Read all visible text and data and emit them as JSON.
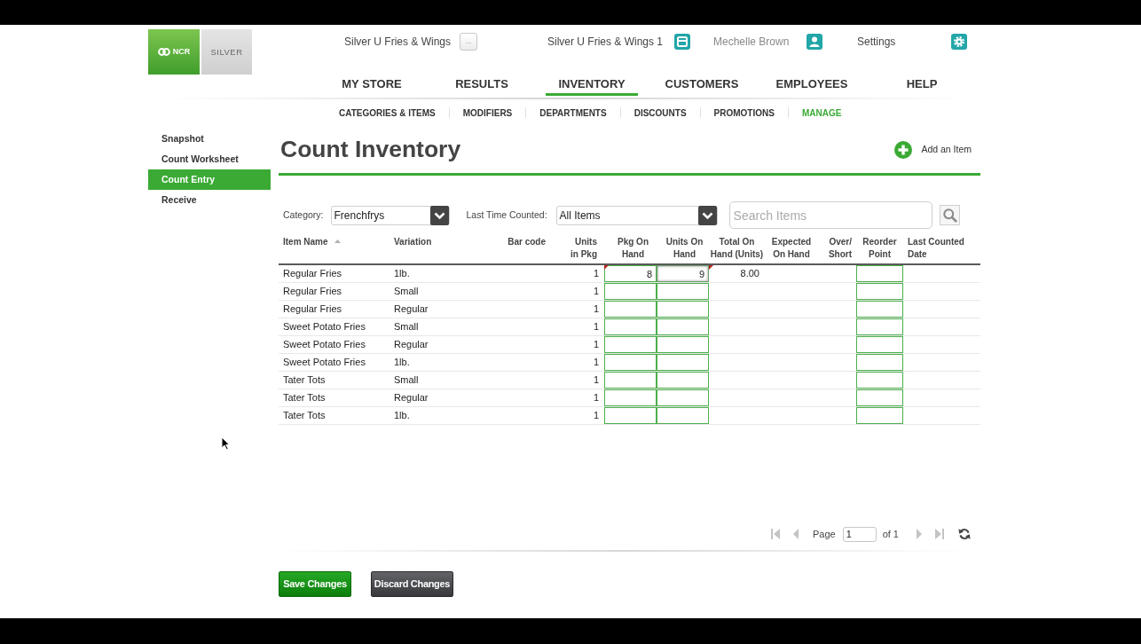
{
  "brand": {
    "company_logo": "NCR",
    "product_logo": "SILVER"
  },
  "account_bar": {
    "store": "Silver U Fries & Wings",
    "store_menu_button": "...",
    "location": "Silver U Fries & Wings 1",
    "user": "Mechelle Brown",
    "settings": "Settings"
  },
  "main_nav": [
    {
      "label": "MY STORE",
      "selected": false
    },
    {
      "label": "RESULTS",
      "selected": false
    },
    {
      "label": "INVENTORY",
      "selected": true
    },
    {
      "label": "CUSTOMERS",
      "selected": false
    },
    {
      "label": "EMPLOYEES",
      "selected": false
    },
    {
      "label": "HELP",
      "selected": false
    }
  ],
  "sub_nav": [
    {
      "label": "CATEGORIES & ITEMS",
      "selected": false
    },
    {
      "label": "MODIFIERS",
      "selected": false
    },
    {
      "label": "DEPARTMENTS",
      "selected": false
    },
    {
      "label": "DISCOUNTS",
      "selected": false
    },
    {
      "label": "PROMOTIONS",
      "selected": false
    },
    {
      "label": "MANAGE",
      "selected": true
    }
  ],
  "sidebar": {
    "items": [
      {
        "label": "Snapshot",
        "selected": false
      },
      {
        "label": "Count Worksheet",
        "selected": false
      },
      {
        "label": "Count Entry",
        "selected": true
      },
      {
        "label": "Receive",
        "selected": false
      }
    ]
  },
  "page": {
    "title": "Count Inventory",
    "add_item_button": "Add an Item"
  },
  "filters": {
    "category": {
      "label": "Category:",
      "value": "Frenchfrys"
    },
    "last_time_counted": {
      "label": "Last Time Counted:",
      "value": "All Items"
    },
    "search": {
      "placeholder": "Search Items"
    }
  },
  "table": {
    "columns": [
      {
        "label": "Item Name",
        "sorted": true
      },
      {
        "label": "Variation",
        "sorted": false
      },
      {
        "label": "Bar code",
        "sorted": false
      },
      {
        "label": "Units\nin Pkg",
        "sorted": false
      },
      {
        "label": "Pkg On\nHand",
        "sorted": false
      },
      {
        "label": "Units On\nHand",
        "sorted": false
      },
      {
        "label": "Total On\nHand (Units)",
        "sorted": false
      },
      {
        "label": "Expected\nOn Hand",
        "sorted": false
      },
      {
        "label": "Over/\nShort",
        "sorted": false
      },
      {
        "label": "Reorder\nPoint",
        "sorted": false
      },
      {
        "label": "Last Counted\nDate",
        "sorted": false
      }
    ],
    "rows": [
      {
        "item_name": "Regular Fries",
        "variation": "1lb.",
        "units_in_pkg": "1",
        "pkg_on_hand": "8",
        "units_on_hand": "9",
        "total_on_hand": "8.00",
        "pkg_on_hand_changed": true,
        "units_on_hand_editing": true,
        "total_changed": true
      },
      {
        "item_name": "Regular Fries",
        "variation": "Small",
        "units_in_pkg": "1",
        "pkg_on_hand_changed": false,
        "units_on_hand_editing": false,
        "total_changed": false
      },
      {
        "item_name": "Regular Fries",
        "variation": "Regular",
        "units_in_pkg": "1",
        "pkg_on_hand_changed": false,
        "units_on_hand_editing": false,
        "total_changed": false
      },
      {
        "item_name": "Sweet Potato Fries",
        "variation": "Small",
        "units_in_pkg": "1",
        "pkg_on_hand_changed": false,
        "units_on_hand_editing": false,
        "total_changed": false
      },
      {
        "item_name": "Sweet Potato Fries",
        "variation": "Regular",
        "units_in_pkg": "1",
        "pkg_on_hand_changed": false,
        "units_on_hand_editing": false,
        "total_changed": false
      },
      {
        "item_name": "Sweet Potato Fries",
        "variation": "1lb.",
        "units_in_pkg": "1",
        "pkg_on_hand_changed": false,
        "units_on_hand_editing": false,
        "total_changed": false
      },
      {
        "item_name": "Tater Tots",
        "variation": "Small",
        "units_in_pkg": "1",
        "pkg_on_hand_changed": false,
        "units_on_hand_editing": false,
        "total_changed": false
      },
      {
        "item_name": "Tater Tots",
        "variation": "Regular",
        "units_in_pkg": "1",
        "pkg_on_hand_changed": false,
        "units_on_hand_editing": false,
        "total_changed": false
      },
      {
        "item_name": "Tater Tots",
        "variation": "1lb.",
        "units_in_pkg": "1",
        "pkg_on_hand_changed": false,
        "units_on_hand_editing": false,
        "total_changed": false
      }
    ]
  },
  "pager": {
    "first": {
      "disabled": true
    },
    "previous": {
      "disabled": true
    },
    "page_label": "Page",
    "page_number": "1",
    "page_count": "of 1",
    "next": {
      "disabled": true
    },
    "last": {
      "disabled": true
    },
    "refresh": {
      "disabled": false
    }
  },
  "actions": [
    {
      "label": "Save Changes",
      "kind": "primary"
    },
    {
      "label": "Discard Changes",
      "kind": "secondary"
    }
  ]
}
